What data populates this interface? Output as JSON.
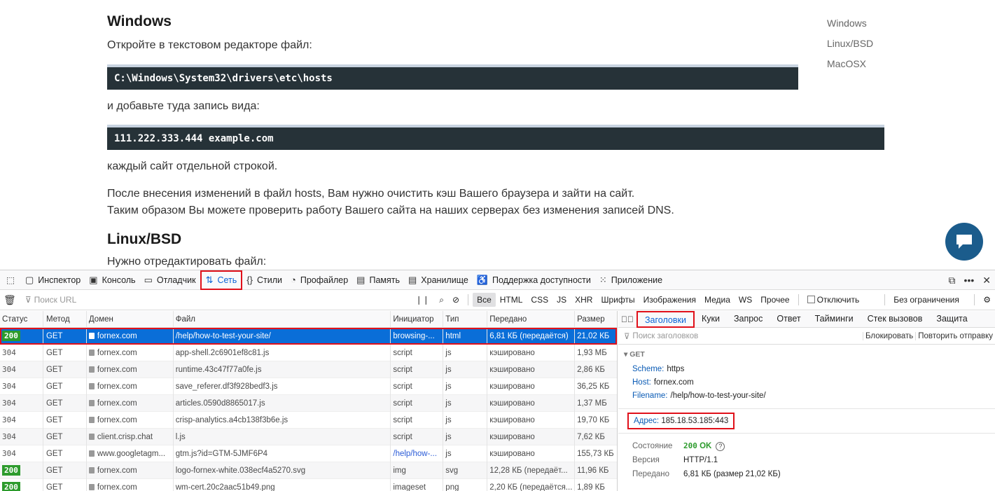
{
  "article": {
    "h_windows": "Windows",
    "p_open": "Откройте в текстовом редакторе файл:",
    "code_path": "C:\\Windows\\System32\\drivers\\etc\\hosts",
    "p_add": "и добавьте туда запись вида:",
    "code_entry": "111.222.333.444 example.com",
    "p_each": "каждый сайт отдельной строкой.",
    "p_after1": "После внесения изменений в файл hosts, Вам нужно очистить кэш Вашего браузера и зайти на сайт.",
    "p_after2": "Таким образом Вы можете проверить работу Вашего сайта на наших серверах без изменения записей DNS.",
    "h_linux": "Linux/BSD",
    "p_edit": "Нужно отредактировать файл:"
  },
  "toc": [
    "Windows",
    "Linux/BSD",
    "MacOSX"
  ],
  "devtools": {
    "tabs": [
      {
        "icon": "▢",
        "label": "Инспектор"
      },
      {
        "icon": "▣",
        "label": "Консоль"
      },
      {
        "icon": "▭",
        "label": "Отладчик"
      },
      {
        "icon": "⇅",
        "label": "Сеть"
      },
      {
        "icon": "{}",
        "label": "Стили"
      },
      {
        "icon": "◔",
        "label": "Профайлер"
      },
      {
        "icon": "▤",
        "label": "Память"
      },
      {
        "icon": "▤",
        "label": "Хранилище"
      },
      {
        "icon": "♿",
        "label": "Поддержка доступности"
      },
      {
        "icon": "⁙",
        "label": "Приложение"
      }
    ],
    "filter": {
      "url_placeholder": "Поиск URL",
      "types": [
        "Все",
        "HTML",
        "CSS",
        "JS",
        "XHR",
        "Шрифты",
        "Изображения",
        "Медиа",
        "WS",
        "Прочее"
      ],
      "disable_cache": "Отключить кэш",
      "throttle": "Без ограничения ÷"
    },
    "columns": [
      "Статус",
      "Метод",
      "Домен",
      "Файл",
      "Инициатор",
      "Тип",
      "Передано",
      "Размер"
    ],
    "rows": [
      {
        "status": "200",
        "method": "GET",
        "domain": "fornex.com",
        "file": "/help/how-to-test-your-site/",
        "initiator": "browsing-...",
        "type": "html",
        "transferred": "6,81 КБ (передаётся)",
        "size": "21,02 КБ"
      },
      {
        "status": "304",
        "method": "GET",
        "domain": "fornex.com",
        "file": "app-shell.2c6901ef8c81.js",
        "initiator": "script",
        "type": "js",
        "transferred": "кэшировано",
        "size": "1,93 МБ"
      },
      {
        "status": "304",
        "method": "GET",
        "domain": "fornex.com",
        "file": "runtime.43c47f77a0fe.js",
        "initiator": "script",
        "type": "js",
        "transferred": "кэшировано",
        "size": "2,86 КБ"
      },
      {
        "status": "304",
        "method": "GET",
        "domain": "fornex.com",
        "file": "save_referer.df3f928bedf3.js",
        "initiator": "script",
        "type": "js",
        "transferred": "кэшировано",
        "size": "36,25 КБ"
      },
      {
        "status": "304",
        "method": "GET",
        "domain": "fornex.com",
        "file": "articles.0590d8865017.js",
        "initiator": "script",
        "type": "js",
        "transferred": "кэшировано",
        "size": "1,37 МБ"
      },
      {
        "status": "304",
        "method": "GET",
        "domain": "fornex.com",
        "file": "crisp-analytics.a4cb138f3b6e.js",
        "initiator": "script",
        "type": "js",
        "transferred": "кэшировано",
        "size": "19,70 КБ"
      },
      {
        "status": "304",
        "method": "GET",
        "domain": "client.crisp.chat",
        "file": "l.js",
        "initiator": "script",
        "type": "js",
        "transferred": "кэшировано",
        "size": "7,62 КБ"
      },
      {
        "status": "304",
        "method": "GET",
        "domain": "www.googletagm...",
        "file": "gtm.js?id=GTM-5JMF6P4",
        "initiator": "/help/how-...",
        "type": "js",
        "transferred": "кэшировано",
        "size": "155,73 КБ"
      },
      {
        "status": "200",
        "method": "GET",
        "domain": "fornex.com",
        "file": "logo-fornex-white.038ecf4a5270.svg",
        "initiator": "img",
        "type": "svg",
        "transferred": "12,28 КБ (передаёт...",
        "size": "11,96 КБ"
      },
      {
        "status": "200",
        "method": "GET",
        "domain": "fornex.com",
        "file": "wm-cert.20c2aac51b49.png",
        "initiator": "imageset",
        "type": "png",
        "transferred": "2,20 КБ (передаётся...",
        "size": "1,89 КБ"
      }
    ],
    "side": {
      "tabs": [
        "Заголовки",
        "Куки",
        "Запрос",
        "Ответ",
        "Тайминги",
        "Стек вызовов",
        "Защита"
      ],
      "filter_placeholder": "Поиск заголовков",
      "block_label": "Блокировать",
      "resend_label": "Повторить отправку",
      "method": "GET",
      "scheme_k": "Scheme:",
      "scheme_v": "https",
      "host_k": "Host:",
      "host_v": "fornex.com",
      "filename_k": "Filename:",
      "filename_v": "/help/how-to-test-your-site/",
      "addr_k": "Адрес:",
      "addr_v": "185.18.53.185:443",
      "state_k": "Состояние",
      "state_code": "200",
      "state_text": "OK",
      "version_k": "Версия",
      "version_v": "HTTP/1.1",
      "sent_k": "Передано",
      "sent_v": "6,81 КБ (размер 21,02 КБ)"
    }
  }
}
